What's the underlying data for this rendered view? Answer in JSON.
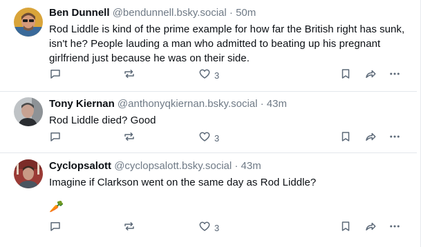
{
  "posts": [
    {
      "name": "Ben Dunnell",
      "handle": "@bendunnell.bsky.social",
      "time": " · 50m",
      "text": "Rod Liddle is kind of the prime example for how far the British right has sunk, isn't he? People lauding a man who admitted to beating up his pregnant girlfriend just because he was on their side.",
      "likes": "3"
    },
    {
      "name": "Tony Kiernan",
      "handle": "@anthonyqkiernan.bsky.social",
      "time": " · 43m",
      "text": "Rod Liddle died?  Good",
      "likes": "3"
    },
    {
      "name": "Cyclopsalott",
      "handle": "@cyclopsalott.bsky.social",
      "time": " · 43m",
      "text": "Imagine if Clarkson went on the same day as Rod Liddle?",
      "emoji": "🥕",
      "likes": "3"
    }
  ],
  "icons": {
    "reply": "reply-icon",
    "repost": "repost-icon",
    "like": "heart-icon",
    "bookmark": "bookmark-icon",
    "share": "share-icon",
    "more": "more-icon"
  },
  "colors": {
    "text": "#0b0f14",
    "muted": "#6f7a86",
    "icon": "#5b6877",
    "divider": "#e3e7ec"
  }
}
